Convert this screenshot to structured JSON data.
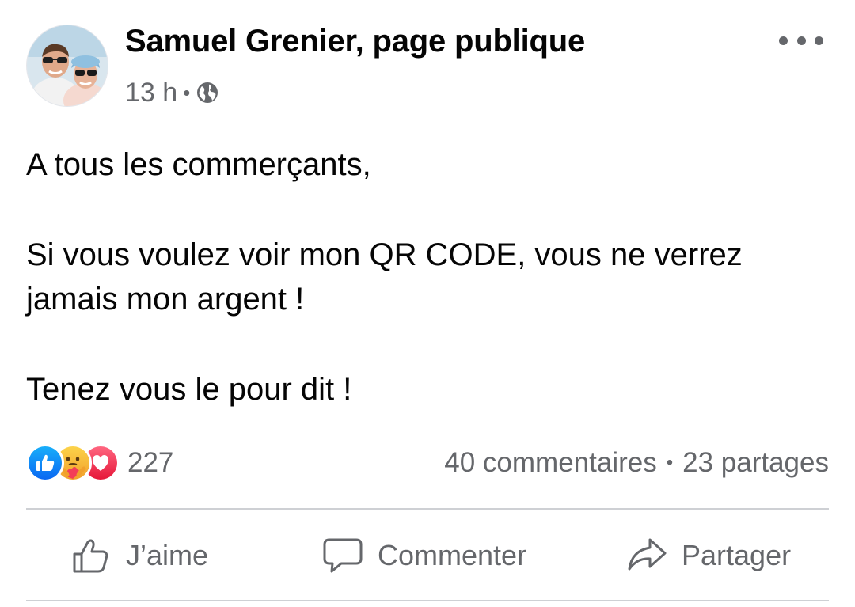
{
  "post": {
    "author": "Samuel Grenier, page publique",
    "time": "13 h",
    "separator": "•",
    "audience_icon": "globe-icon",
    "text": {
      "line1": "A tous les commerçants,",
      "line2": "Si vous voulez voir mon QR CODE, vous ne verrez jamais mon argent !",
      "line3": "Tenez vous le pour dit !"
    }
  },
  "reactions": {
    "types": [
      "like",
      "care",
      "love"
    ],
    "count": "227"
  },
  "stats": {
    "comments": "40 commentaires",
    "separator": "•",
    "shares": "23 partages"
  },
  "actions": {
    "like_label": "J’aime",
    "comment_label": "Commenter",
    "share_label": "Partager"
  },
  "colors": {
    "like_blue": "#1877f2",
    "love_red": "#f33e58",
    "care_yellow": "#f7b125",
    "secondary_text": "#65676b",
    "divider": "#ced0d4"
  }
}
